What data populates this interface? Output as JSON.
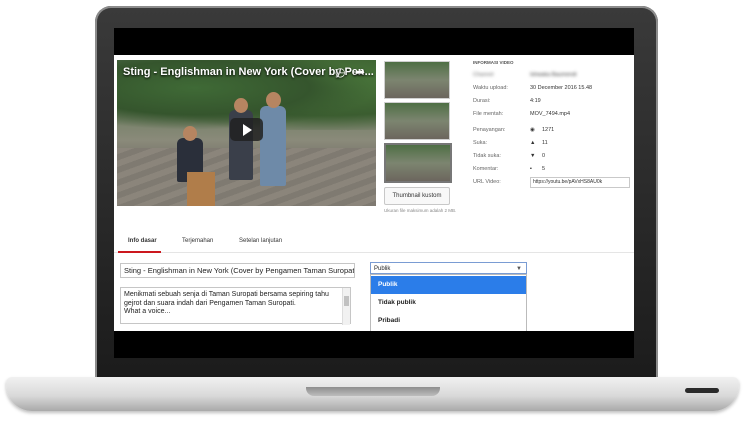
{
  "video": {
    "title": "Sting - Englishman in New York (Cover by Pen...",
    "clock_icon": "clock-icon",
    "share_icon": "share-icon",
    "play_icon": "play-icon"
  },
  "thumbnails": {
    "custom_button": "Thumbnail kustom",
    "note": "Ukuran file maksimum adalah 2 MB."
  },
  "info": {
    "header": "INFORMASI VIDEO",
    "channel_label": "Channel",
    "channel_value": "Ishwaka Baumendi",
    "rows": [
      {
        "label": "Waktu upload:",
        "value": "30 December 2016 15.48"
      },
      {
        "label": "Durasi:",
        "value": "4:19"
      },
      {
        "label": "File mentah:",
        "value": "MOV_7494.mp4"
      }
    ],
    "stats": [
      {
        "label": "Penayangan:",
        "icon": "eye-icon",
        "value": "1271"
      },
      {
        "label": "Suka:",
        "icon": "thumbs-up-icon",
        "value": "11"
      },
      {
        "label": "Tidak suka:",
        "icon": "thumbs-down-icon",
        "value": "0"
      },
      {
        "label": "Komentar:",
        "icon": "comment-icon",
        "value": "5"
      }
    ],
    "url_label": "URL Video:",
    "url_value": "https://youtu.be/pAVxHS8AU0k"
  },
  "tabs": [
    {
      "label": "Info dasar",
      "active": true
    },
    {
      "label": "Terjemahan",
      "active": false
    },
    {
      "label": "Setelan lanjutan",
      "active": false
    }
  ],
  "form": {
    "title_value": "Sting - Englishman in New York (Cover by Pengamen Taman Suropati)",
    "description": "Menikmati sebuah senja di Taman Suropati bersama sepiring tahu gejrot dan suara indah dari Pengamen Taman Suropati.\nWhat a voice...",
    "privacy_selected": "Publik",
    "privacy_options": [
      "Publik",
      "Tidak publik",
      "Pribadi"
    ]
  },
  "colors": {
    "accent_red": "#cc181e",
    "dropdown_highlight": "#2b7de9"
  }
}
